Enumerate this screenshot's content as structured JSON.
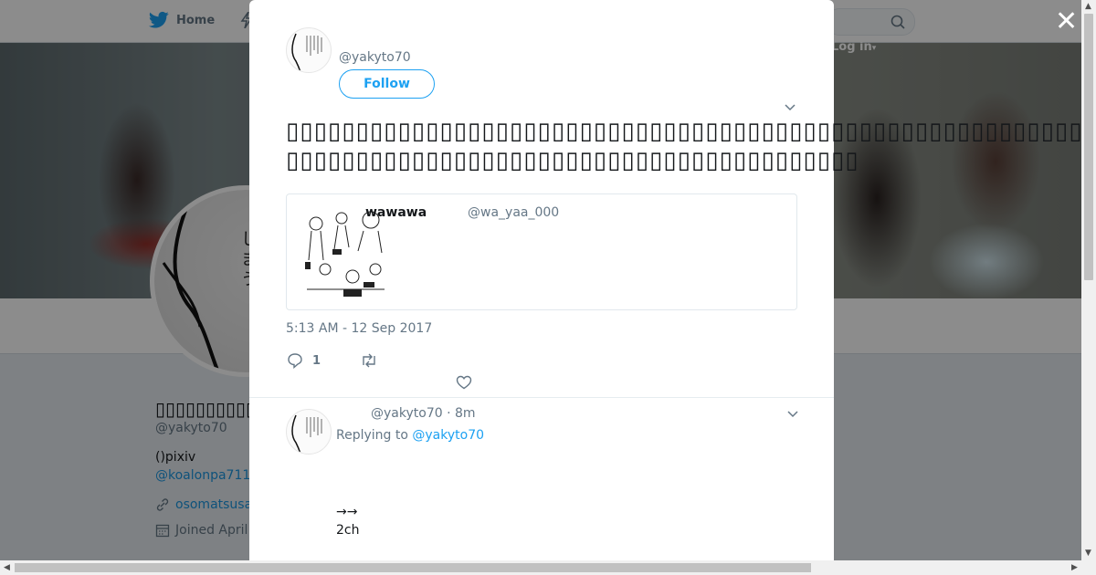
{
  "topbar": {
    "home_label": "Home",
    "login_label": "Log in"
  },
  "profile": {
    "name": "▯▯▯▯▯▯▯▯▯▯",
    "handle": "@yakyto70",
    "bio": "()pixiv",
    "bio_link": "@koalonpa711",
    "url": "osomatsusa",
    "joined": "Joined April"
  },
  "tweet": {
    "handle": "@yakyto70",
    "follow_label": "Follow",
    "text": "▯▯▯▯▯▯▯▯▯▯▯▯▯▯▯▯▯▯▯▯▯▯▯▯▯▯▯▯▯▯▯▯▯▯▯▯▯▯▯▯▯▯▯▯▯▯▯▯▯▯▯▯▯▯▯▯▯▯▯▯▯▯▯▯▯▯▯▯▯▯▯▯▯▯▯▯▯▯▯▯▯▯▯▯▯▯▯▯▯▯▯▯▯▯▯▯▯▯",
    "quote_name": "wawawa",
    "quote_handle": "@wa_yaa_000",
    "timestamp": "5:13 AM - 12 Sep 2017",
    "reply_count": "1"
  },
  "reply": {
    "handle_time": "@yakyto70 · 8m",
    "replying_prefix": "Replying to",
    "replying_to": "@yakyto70",
    "line1": "→→",
    "line2": "2ch"
  },
  "colors": {
    "accent": "#1da1f2",
    "muted": "#657786",
    "text": "#14171a"
  },
  "icons": [
    "twitter-bird-icon",
    "moments-icon",
    "search-icon",
    "close-icon",
    "chevron-down-icon",
    "reply-icon",
    "retweet-icon",
    "heart-icon",
    "link-icon",
    "calendar-icon"
  ]
}
